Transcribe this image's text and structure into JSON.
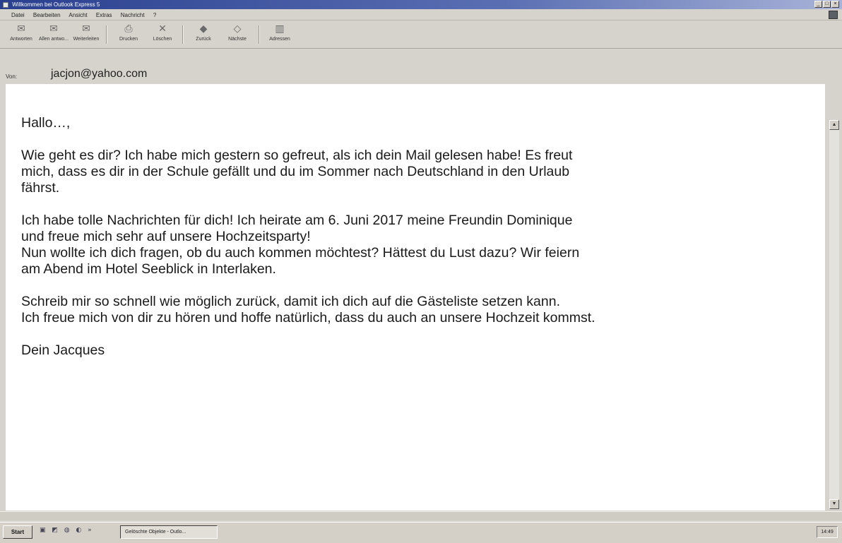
{
  "window": {
    "title": "Willkommen bei Outlook Express 5",
    "controls": [
      "_",
      "□",
      "×"
    ]
  },
  "menu": [
    "Datei",
    "Bearbeiten",
    "Ansicht",
    "Extras",
    "Nachricht",
    "?"
  ],
  "toolbar": {
    "buttons": [
      {
        "label": "Antworten",
        "icon": "reply-icon",
        "glyph": "✉"
      },
      {
        "label": "Allen antwo...",
        "icon": "reply-all-icon",
        "glyph": "✉"
      },
      {
        "label": "Weiterleiten",
        "icon": "forward-icon",
        "glyph": "✉"
      },
      {
        "label": "Drucken",
        "icon": "print-icon",
        "glyph": "⎙"
      },
      {
        "label": "Löschen",
        "icon": "delete-icon",
        "glyph": "✕"
      },
      {
        "label": "Zurück",
        "icon": "back-icon",
        "glyph": "◆"
      },
      {
        "label": "Nächste",
        "icon": "next-icon",
        "glyph": "◇"
      },
      {
        "label": "Adressen",
        "icon": "address-book-icon",
        "glyph": "▥"
      }
    ]
  },
  "header": {
    "from_label": "Von:",
    "from_value": "jacjon@yahoo.com"
  },
  "message": {
    "paragraphs": [
      "Hallo…,",
      "Wie geht es dir? Ich habe mich gestern so gefreut, als ich dein Mail gelesen habe! Es freut\nmich, dass es dir in der Schule gefällt und du im Sommer nach Deutschland in den Urlaub\nfährst.",
      "Ich habe tolle Nachrichten für dich! Ich heirate am 6. Juni 2017 meine Freundin Dominique\nund freue mich sehr auf unsere Hochzeitsparty!\nNun wollte ich dich fragen, ob du auch kommen möchtest? Hättest du Lust dazu? Wir feiern\nam Abend im Hotel Seeblick in Interlaken.",
      "Schreib mir so schnell wie möglich zurück, damit ich dich auf die Gästeliste setzen kann.\nIch freue mich von dir zu hören und hoffe natürlich, dass du auch an unsere Hochzeit kommst.",
      "Dein Jacques"
    ]
  },
  "taskbar": {
    "start_label": "Start",
    "quick_launch": "▣ ◩ ◍ ◐ »",
    "task_label": "Gelöschte Objekte - Outlo...",
    "clock": "14:49"
  }
}
